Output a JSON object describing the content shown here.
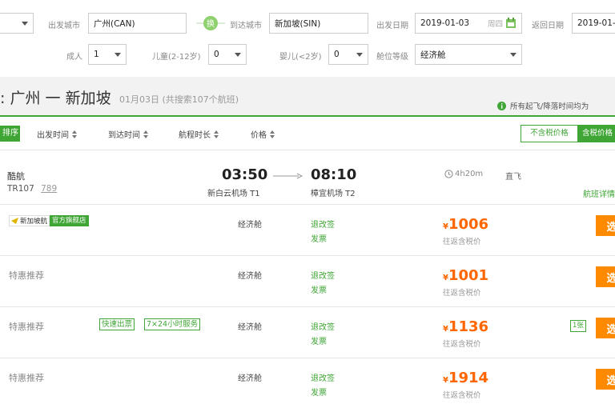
{
  "search": {
    "from_label": "出发城市",
    "from_value": "广州(CAN)",
    "swap_label": "换",
    "to_label": "到达城市",
    "to_value": "新加坡(SIN)",
    "depart_label": "出发日期",
    "depart_value": "2019-01-03",
    "depart_weekday": "周四",
    "return_label": "返回日期",
    "return_value": "2019-01-",
    "adult_label": "成人",
    "adult_value": "1",
    "child_label": "儿童(2-12岁)",
    "child_value": "0",
    "infant_label": "婴儿(<2岁)",
    "infant_value": "0",
    "cabin_label": "舱位等级",
    "cabin_value": "经济舱"
  },
  "route": {
    "prefix": ":",
    "from": "广州",
    "dash": "一",
    "to": "新加坡",
    "info": "01月03日 (共搜索107个航班)",
    "notice": "所有起飞/降落时间均为"
  },
  "sortbar": {
    "active": "排序",
    "items": [
      "出发时间",
      "到达时间",
      "航程时长",
      "价格"
    ],
    "toggle_off": "不含税价格",
    "toggle_on": "含税价格"
  },
  "flight": {
    "airline": "酷航",
    "number": "TR107",
    "aircraft": "789",
    "dep_time": "03:50",
    "dep_airport": "新白云机场 T1",
    "arr_time": "08:10",
    "arr_airport": "樟宜机场 T2",
    "duration": "4h20m",
    "stop": "直飞",
    "detail_link": "航班详情"
  },
  "offers": [
    {
      "vendor": "新加坡航",
      "vendor_badge": "官方旗舰店",
      "cabin": "经济舱",
      "refund": "退改签",
      "invoice": "发票",
      "currency": "¥",
      "price": "1006",
      "price_note": "往返含税价",
      "button": "选"
    },
    {
      "vendor": "特惠推荐",
      "cabin": "经济舱",
      "refund": "退改签",
      "invoice": "发票",
      "currency": "¥",
      "price": "1001",
      "price_note": "往返含税价",
      "button": "选"
    },
    {
      "vendor": "特惠推荐",
      "tag1": "快速出票",
      "tag2": "7×24小时服务",
      "cabin": "经济舱",
      "refund": "退改签",
      "invoice": "发票",
      "currency": "¥",
      "price": "1136",
      "price_note": "往返含税价",
      "extra_tag": "1张",
      "button": "选"
    },
    {
      "vendor": "特惠推荐",
      "cabin": "经济舱",
      "refund": "退改签",
      "invoice": "发票",
      "currency": "¥",
      "price": "1914",
      "price_note": "往返含税价",
      "button": "选"
    }
  ],
  "colors": {
    "accent_green": "#3fa535",
    "price_orange": "#ff6600",
    "button_orange": "#ff8a00"
  }
}
